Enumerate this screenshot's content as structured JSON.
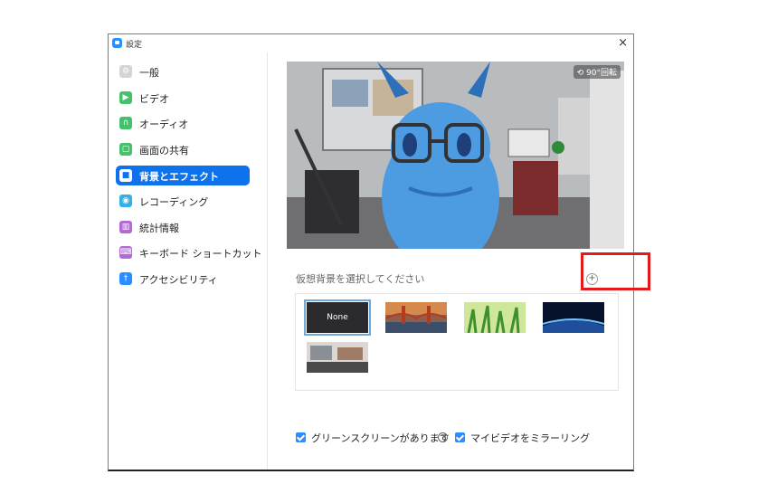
{
  "window": {
    "title": "設定",
    "close_glyph": "×"
  },
  "sidebar": {
    "items": [
      {
        "label": "一般",
        "icon": "gear-icon",
        "color": "#cfcfcf",
        "glyph": "⚙"
      },
      {
        "label": "ビデオ",
        "icon": "video-icon",
        "color": "#46c06c",
        "glyph": "▶"
      },
      {
        "label": "オーディオ",
        "icon": "headphones-icon",
        "color": "#46c06c",
        "glyph": "∩"
      },
      {
        "label": "画面の共有",
        "icon": "share-screen-icon",
        "color": "#46c06c",
        "glyph": "▢"
      },
      {
        "label": "背景とエフェクト",
        "icon": "background-icon",
        "color": "#ffffff",
        "glyph": "■",
        "active": true
      },
      {
        "label": "レコーディング",
        "icon": "record-icon",
        "color": "#35b0e6",
        "glyph": "◉"
      },
      {
        "label": "統計情報",
        "icon": "statistics-icon",
        "color": "#b36ad6",
        "glyph": "▥"
      },
      {
        "label": "キーボード ショートカット",
        "icon": "keyboard-icon",
        "color": "#b36ad6",
        "glyph": "⌨"
      },
      {
        "label": "アクセシビリティ",
        "icon": "accessibility-icon",
        "color": "#2d8cff",
        "glyph": "†"
      }
    ]
  },
  "preview": {
    "rotate_label": "⟲ 90°回転"
  },
  "virtual_background": {
    "label": "仮想背景を選択してください",
    "add_glyph": "+",
    "thumbnails": [
      {
        "name": "None",
        "label": "None"
      },
      {
        "name": "golden-gate-bridge"
      },
      {
        "name": "grass"
      },
      {
        "name": "earth-from-space"
      },
      {
        "name": "office-room"
      }
    ]
  },
  "options": {
    "green_screen_label": "グリーンスクリーンがあります",
    "green_screen_checked": true,
    "help_glyph": "?",
    "mirror_label": "マイビデオをミラーリング",
    "mirror_checked": true
  },
  "colors": {
    "accent": "#0e72ed",
    "highlight": "#e21a1a"
  }
}
